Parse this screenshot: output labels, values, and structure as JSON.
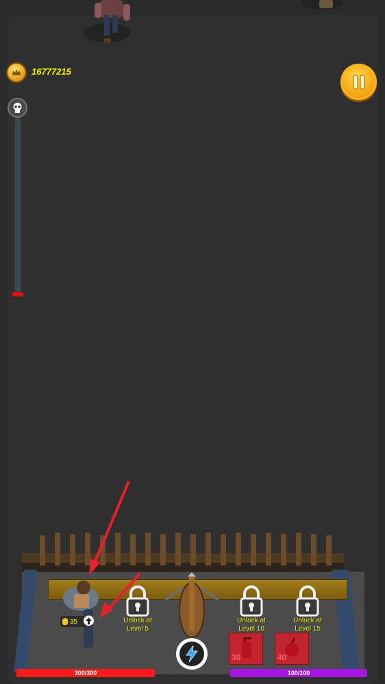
{
  "hud": {
    "coins": "16777215",
    "coin_icon": "crown-coin-icon",
    "pause_icon": "pause-icon",
    "wave_icon": "skull-icon",
    "wave_progress": 0.0
  },
  "hero": {
    "upgrade_cost": "35",
    "upgrade_icon": "up-arrow-icon"
  },
  "slots": [
    {
      "label_line1": "Unlock at",
      "label_line2": "Level 5"
    },
    {
      "label_line1": "Unlock at",
      "label_line2": "Level 10"
    },
    {
      "label_line1": "Unlock at",
      "label_line2": "Level 15"
    }
  ],
  "powerups": [
    {
      "cost": "30",
      "icon": "fire-extinguisher-icon"
    },
    {
      "cost": "40",
      "icon": "bomb-icon"
    }
  ],
  "skill": {
    "icon": "lightning-icon"
  },
  "bars": {
    "health": {
      "text": "300/300",
      "current": 300,
      "max": 300,
      "color": "#ff1a1a"
    },
    "mana": {
      "text": "100/100",
      "current": 100,
      "max": 100,
      "color": "#a514e0"
    }
  },
  "colors": {
    "coin_text": "#f3ef12",
    "pause": "#f2a30f",
    "arrow": "#e8202a"
  }
}
